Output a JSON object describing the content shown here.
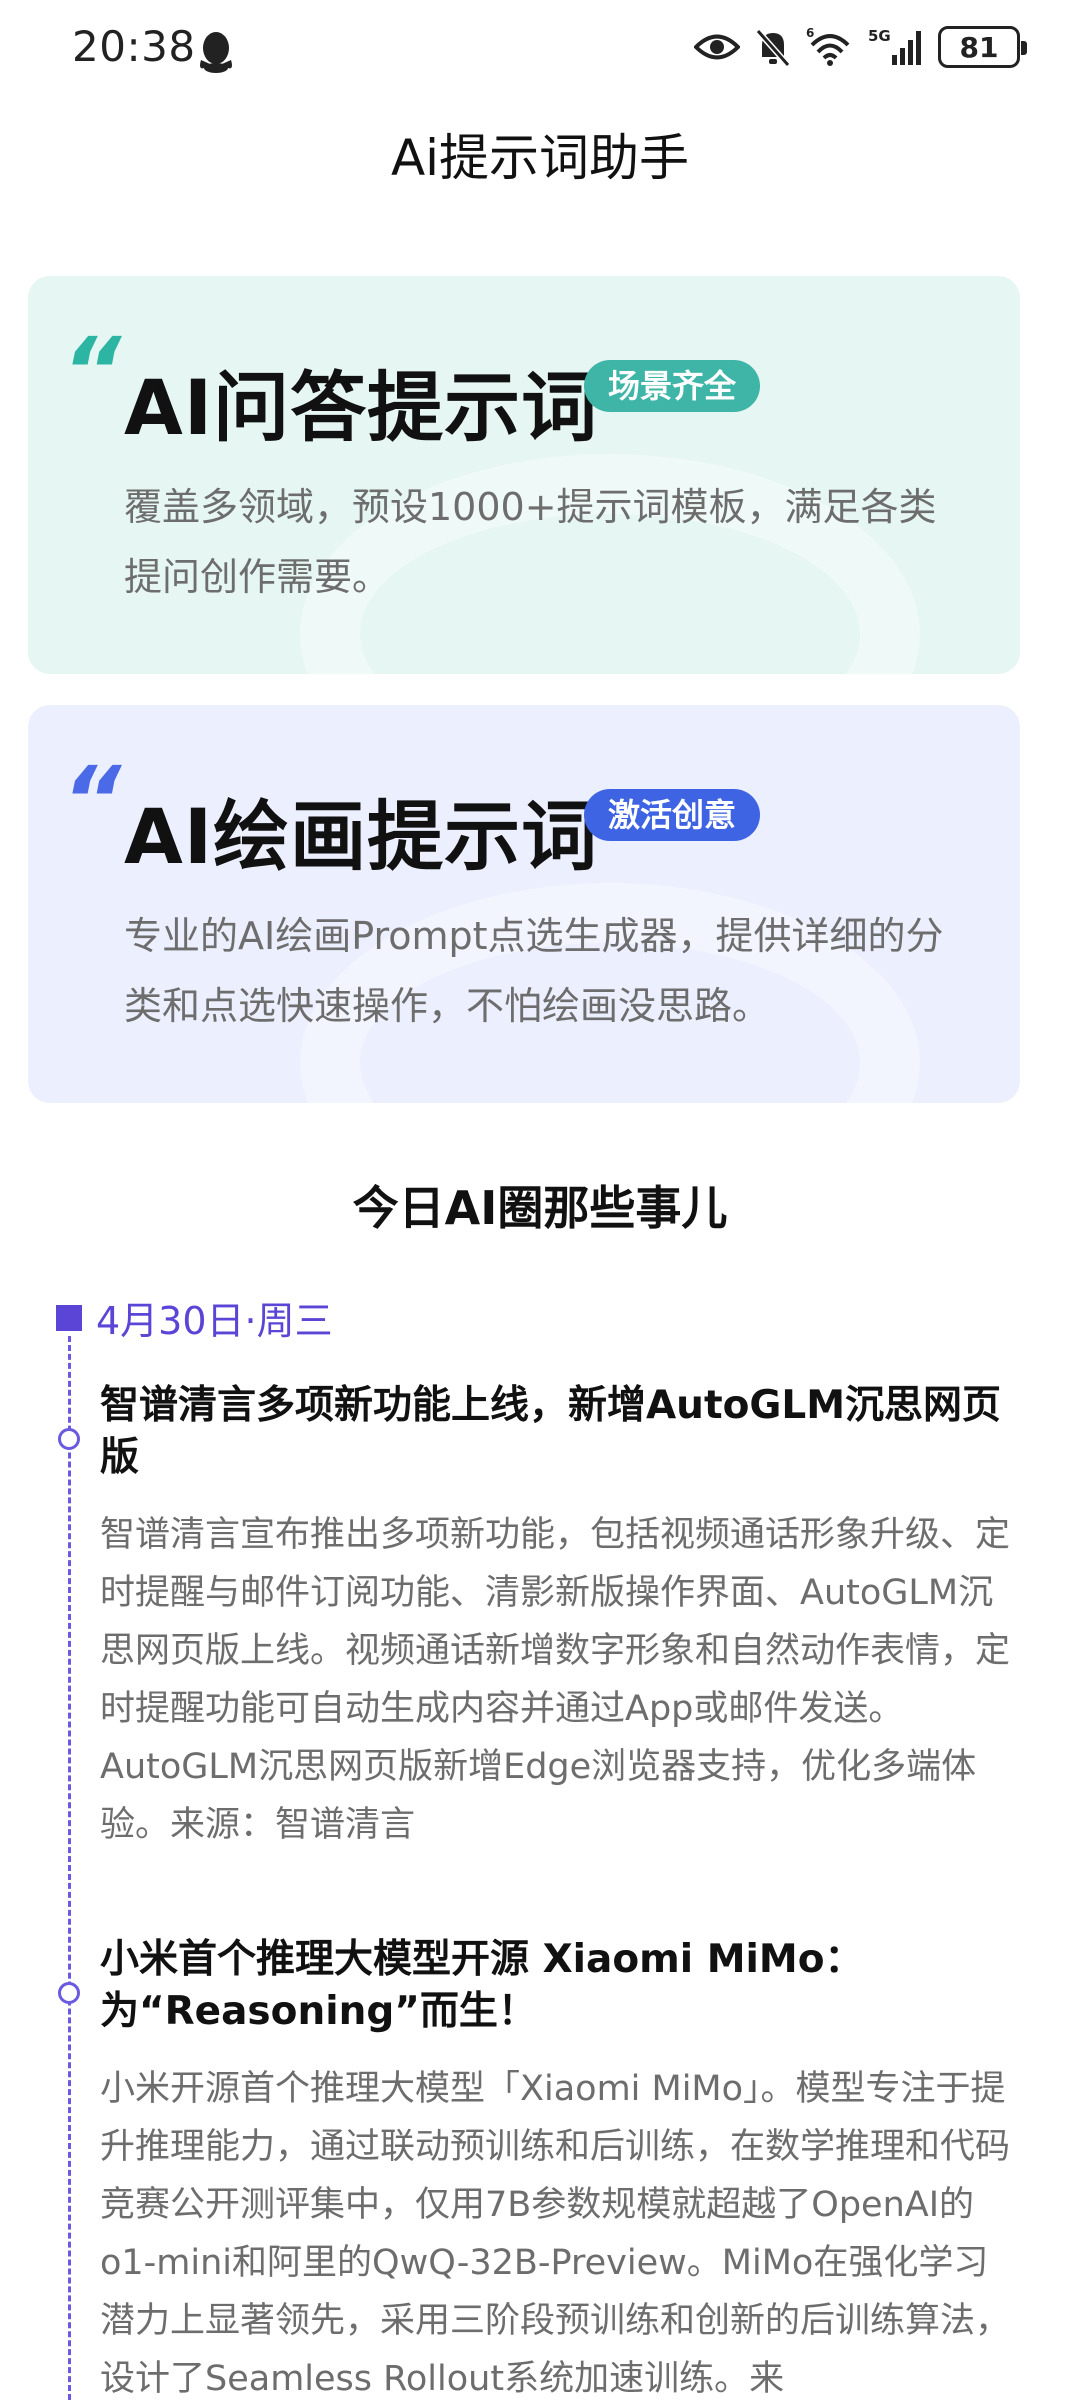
{
  "status_bar": {
    "time": "20:38",
    "battery": "81",
    "network": "5G",
    "wifi_superscript": "6",
    "icons": [
      "qq-icon",
      "eye-icon",
      "mute-bell-icon",
      "wifi-icon",
      "signal-icon",
      "battery-icon"
    ]
  },
  "header": {
    "title": "Ai提示词助手"
  },
  "cards": [
    {
      "title": "AI问答提示词",
      "tag": "场景齐全",
      "desc": "覆盖多领域，预设1000+提示词模板，满足各类提问创作需要。",
      "quote": "“"
    },
    {
      "title": "AI绘画提示词",
      "tag": "激活创意",
      "desc": "专业的AI绘画Prompt点选生成器，提供详细的分类和点选快速操作，不怕绘画没思路。",
      "quote": "“"
    }
  ],
  "news_section": {
    "title": "今日AI圈那些事儿",
    "date": "4月30日·周三",
    "items": [
      {
        "title": "智谱清言多项新功能上线，新增AutoGLM沉思网页版",
        "body": "智谱清言宣布推出多项新功能，包括视频通话形象升级、定时提醒与邮件订阅功能、清影新版操作界面、AutoGLM沉思网页版上线。视频通话新增数字形象和自然动作表情，定时提醒功能可自动生成内容并通过App或邮件发送。AutoGLM沉思网页版新增Edge浏览器支持，优化多端体验。来源：智谱清言"
      },
      {
        "title": "小米首个推理大模型开源 Xiaomi MiMo：为“Reasoning”而生！",
        "body": "小米开源首个推理大模型「Xiaomi MiMo」。模型专注于提升推理能力，通过联动预训练和后训练，在数学推理和代码竞赛公开测评集中，仅用7B参数规模就超越了OpenAI的o1-mini和阿里的QwQ-32B-Preview。MiMo在强化学习潜力上显著领先，采用三阶段预训练和创新的后训练算法，设计了Seamless Rollout系统加速训练。来"
      }
    ]
  },
  "colors": {
    "qa_card_bg": "#e6f6f3",
    "qa_accent": "#3fb5a7",
    "draw_card_bg": "#eceffd",
    "draw_accent": "#3f64e3",
    "timeline_accent": "#5a45d6"
  }
}
